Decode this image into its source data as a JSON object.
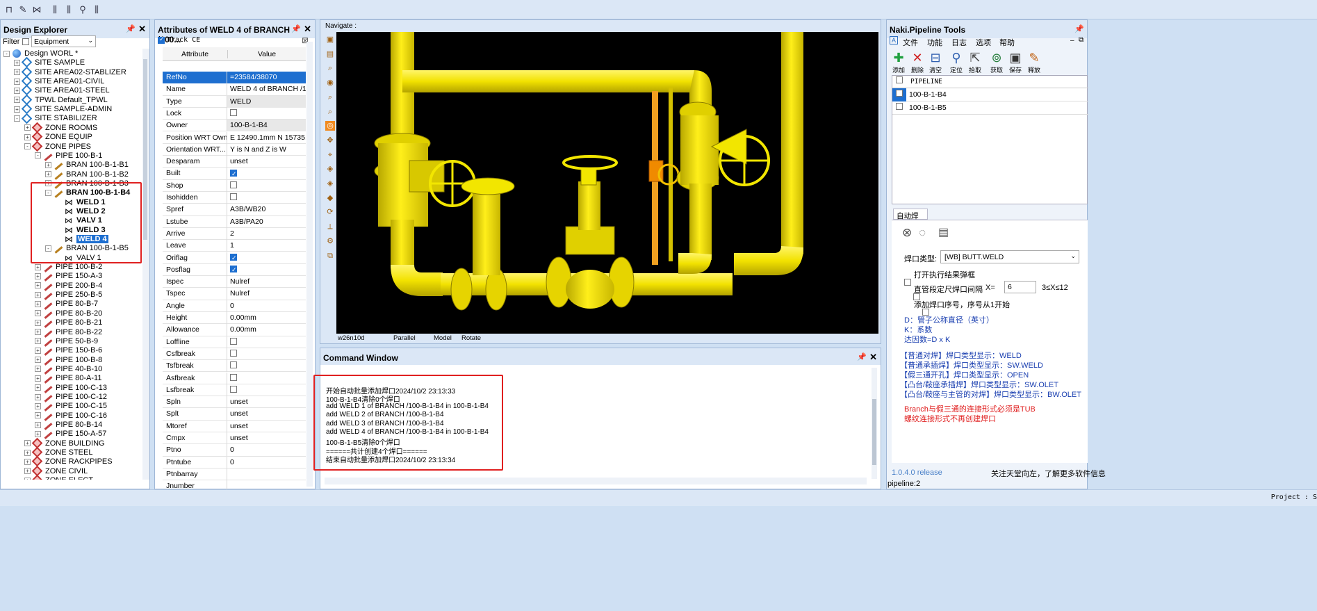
{
  "toolbar": {
    "icons": [
      "pipe-tool-icon",
      "pencil-icon",
      "pipe-edit-icon",
      "valve-a-icon",
      "valve-b-icon",
      "valve-c-icon",
      "valve-d-icon",
      "valve-e-icon"
    ]
  },
  "design_explorer": {
    "title": "Design Explorer",
    "filter_label": "Filter",
    "filter_value": "Equipment",
    "tree": [
      {
        "label": "Design WORL *",
        "level": 0,
        "icon": "globe",
        "exp": "-"
      },
      {
        "label": "SITE SAMPLE",
        "level": 1,
        "icon": "site",
        "exp": "+"
      },
      {
        "label": "SITE AREA02-STABLIZER",
        "level": 1,
        "icon": "site",
        "exp": "+"
      },
      {
        "label": "SITE AREA01-CIVIL",
        "level": 1,
        "icon": "site",
        "exp": "+"
      },
      {
        "label": "SITE AREA01-STEEL",
        "level": 1,
        "icon": "site",
        "exp": "+"
      },
      {
        "label": "TPWL Default_TPWL",
        "level": 1,
        "icon": "site",
        "exp": "+"
      },
      {
        "label": "SITE SAMPLE-ADMIN",
        "level": 1,
        "icon": "site",
        "exp": "+"
      },
      {
        "label": "SITE STABILIZER",
        "level": 1,
        "icon": "site",
        "exp": "-"
      },
      {
        "label": "ZONE ROOMS",
        "level": 2,
        "icon": "zone",
        "exp": "+"
      },
      {
        "label": "ZONE EQUIP",
        "level": 2,
        "icon": "zone",
        "exp": "+"
      },
      {
        "label": "ZONE PIPES",
        "level": 2,
        "icon": "zone",
        "exp": "-"
      },
      {
        "label": "PIPE 100-B-1",
        "level": 3,
        "icon": "pipe",
        "exp": "-"
      },
      {
        "label": "BRAN 100-B-1-B1",
        "level": 4,
        "icon": "bran",
        "exp": "+"
      },
      {
        "label": "BRAN 100-B-1-B2",
        "level": 4,
        "icon": "bran",
        "exp": "+"
      },
      {
        "label": "BRAN 100-B-1-B3",
        "level": 4,
        "icon": "bran",
        "exp": "+"
      },
      {
        "label": "BRAN 100-B-1-B4",
        "level": 4,
        "icon": "bran",
        "exp": "-",
        "bold": true
      },
      {
        "label": "WELD 1",
        "level": 5,
        "icon": "weld",
        "bold": true
      },
      {
        "label": "WELD 2",
        "level": 5,
        "icon": "weld",
        "bold": true
      },
      {
        "label": "VALV 1",
        "level": 5,
        "icon": "valv",
        "bold": true
      },
      {
        "label": "WELD 3",
        "level": 5,
        "icon": "weld",
        "bold": true
      },
      {
        "label": "WELD 4",
        "level": 5,
        "icon": "weld",
        "bold": true,
        "selected": true
      },
      {
        "label": "BRAN 100-B-1-B5",
        "level": 4,
        "icon": "bran",
        "exp": "-"
      },
      {
        "label": "VALV 1",
        "level": 5,
        "icon": "valv"
      },
      {
        "label": "PIPE 100-B-2",
        "level": 3,
        "icon": "pipe",
        "exp": "+"
      },
      {
        "label": "PIPE 150-A-3",
        "level": 3,
        "icon": "pipe",
        "exp": "+"
      },
      {
        "label": "PIPE 200-B-4",
        "level": 3,
        "icon": "pipe",
        "exp": "+"
      },
      {
        "label": "PIPE 250-B-5",
        "level": 3,
        "icon": "pipe",
        "exp": "+"
      },
      {
        "label": "PIPE 80-B-7",
        "level": 3,
        "icon": "pipe",
        "exp": "+"
      },
      {
        "label": "PIPE 80-B-20",
        "level": 3,
        "icon": "pipe",
        "exp": "+"
      },
      {
        "label": "PIPE 80-B-21",
        "level": 3,
        "icon": "pipe",
        "exp": "+"
      },
      {
        "label": "PIPE 80-B-22",
        "level": 3,
        "icon": "pipe",
        "exp": "+"
      },
      {
        "label": "PIPE 50-B-9",
        "level": 3,
        "icon": "pipe",
        "exp": "+"
      },
      {
        "label": "PIPE 150-B-6",
        "level": 3,
        "icon": "pipe",
        "exp": "+"
      },
      {
        "label": "PIPE 100-B-8",
        "level": 3,
        "icon": "pipe",
        "exp": "+"
      },
      {
        "label": "PIPE 40-B-10",
        "level": 3,
        "icon": "pipe",
        "exp": "+"
      },
      {
        "label": "PIPE 80-A-11",
        "level": 3,
        "icon": "pipe",
        "exp": "+"
      },
      {
        "label": "PIPE 100-C-13",
        "level": 3,
        "icon": "pipe",
        "exp": "+"
      },
      {
        "label": "PIPE 100-C-12",
        "level": 3,
        "icon": "pipe",
        "exp": "+"
      },
      {
        "label": "PIPE 100-C-15",
        "level": 3,
        "icon": "pipe",
        "exp": "+"
      },
      {
        "label": "PIPE 100-C-16",
        "level": 3,
        "icon": "pipe",
        "exp": "+"
      },
      {
        "label": "PIPE 80-B-14",
        "level": 3,
        "icon": "pipe",
        "exp": "+"
      },
      {
        "label": "PIPE 150-A-57",
        "level": 3,
        "icon": "pipe",
        "exp": "+"
      },
      {
        "label": "ZONE BUILDING",
        "level": 2,
        "icon": "zone",
        "exp": "+"
      },
      {
        "label": "ZONE STEEL",
        "level": 2,
        "icon": "zone",
        "exp": "+"
      },
      {
        "label": "ZONE RACKPIPES",
        "level": 2,
        "icon": "zone",
        "exp": "+"
      },
      {
        "label": "ZONE CIVIL",
        "level": 2,
        "icon": "zone",
        "exp": "+"
      },
      {
        "label": "ZONE ELECT",
        "level": 2,
        "icon": "zone",
        "exp": "+"
      }
    ]
  },
  "attributes": {
    "title": "Attributes of WELD 4 of BRANCH /100...",
    "track_label": "Track CE",
    "col_attribute": "Attribute",
    "col_value": "Value",
    "rows": [
      {
        "name": "RefNo",
        "value": "=23584/38070",
        "selected": true
      },
      {
        "name": "Name",
        "value": "WELD 4 of BRANCH /1..."
      },
      {
        "name": "Type",
        "value": "WELD",
        "gray": true
      },
      {
        "name": "Lock",
        "check": false
      },
      {
        "name": "Owner",
        "value": "100-B-1-B4",
        "gray": true
      },
      {
        "name": "Position WRT Owner",
        "value": "E 12490.1mm N 15735...."
      },
      {
        "name": "Orientation WRT...",
        "value": "Y is N and Z is W"
      },
      {
        "name": "Desparam",
        "value": "unset"
      },
      {
        "name": "Built",
        "check": true
      },
      {
        "name": "Shop",
        "check": false
      },
      {
        "name": "Isohidden",
        "check": false
      },
      {
        "name": "Spref",
        "value": "A3B/WB20"
      },
      {
        "name": "Lstube",
        "value": "A3B/PA20"
      },
      {
        "name": "Arrive",
        "value": "2"
      },
      {
        "name": "Leave",
        "value": "1"
      },
      {
        "name": "Oriflag",
        "check": true
      },
      {
        "name": "Posflag",
        "check": true
      },
      {
        "name": "Ispec",
        "value": "Nulref"
      },
      {
        "name": "Tspec",
        "value": "Nulref"
      },
      {
        "name": "Angle",
        "value": "0"
      },
      {
        "name": "Height",
        "value": "0.00mm"
      },
      {
        "name": "Allowance",
        "value": "0.00mm"
      },
      {
        "name": "Loffline",
        "check": false
      },
      {
        "name": "Csfbreak",
        "check": false
      },
      {
        "name": "Tsfbreak",
        "check": false
      },
      {
        "name": "Asfbreak",
        "check": false
      },
      {
        "name": "Lsfbreak",
        "check": false
      },
      {
        "name": "Spln",
        "value": "unset"
      },
      {
        "name": "Splt",
        "value": "unset"
      },
      {
        "name": "Mtoref",
        "value": "unset"
      },
      {
        "name": "Cmpx",
        "value": "unset"
      },
      {
        "name": "Ptno",
        "value": "0"
      },
      {
        "name": "Ptntube",
        "value": "0"
      },
      {
        "name": "Ptnbarray",
        "value": ""
      },
      {
        "name": "Jnumber",
        "value": ""
      }
    ]
  },
  "navigate": {
    "title": "Navigate :",
    "status": [
      "w26n10d",
      "Parallel",
      "Model",
      "Rotate"
    ]
  },
  "command_window": {
    "title": "Command Window",
    "lines": [
      "开始自动批量添加焊口2024/10/2 23:13:33",
      "100-B-1-B4清除0个焊口",
      "add WELD 1 of BRANCH /100-B-1-B4 in 100-B-1-B4",
      "add WELD 2 of BRANCH /100-B-1-B4",
      "add WELD 3 of BRANCH /100-B-1-B4",
      "add WELD 4 of BRANCH /100-B-1-B4 in 100-B-1-B4",
      "100-B-1-B5清除0个焊口",
      "======共计创建4个焊口======",
      "结束自动批量添加焊口2024/10/2 23:13:34"
    ]
  },
  "naki": {
    "title": "Naki.Pipeline Tools",
    "menu": [
      "文件",
      "功能",
      "日志",
      "选项",
      "帮助"
    ],
    "tools": [
      {
        "label": "添加",
        "icon": "add-icon"
      },
      {
        "label": "删除",
        "icon": "delete-icon"
      },
      {
        "label": "清空",
        "icon": "clear-icon"
      },
      {
        "label": "定位",
        "icon": "locate-icon"
      },
      {
        "label": "拾取",
        "icon": "pick-icon"
      },
      {
        "label": "获取",
        "icon": "fetch-icon"
      },
      {
        "label": "保存",
        "icon": "save-icon"
      },
      {
        "label": "释放",
        "icon": "release-icon"
      }
    ],
    "list_header": "PIPELINE",
    "list_items": [
      "100-B-1-B4",
      "100-B-1-B5"
    ],
    "tab_label": "自动焊口",
    "weld_type_label": "焊口类型:",
    "weld_type_value": "[WB] BUTT.WELD",
    "opt_open_result": "打开执行结果弹框",
    "opt_spacing": "直管段定尺焊口间隔",
    "x_label": "X=",
    "x_value": "6",
    "x_range": "3≤X≤12",
    "opt_seq": "添加焊口序号，序号从1开始",
    "info_blue": [
      "D：管子公称直径（英寸）",
      "K：系数",
      "达因数=D x K"
    ],
    "info_types": [
      "【普通对焊】焊口类型显示：WELD",
      "【普通承插焊】焊口类型显示：SW.WELD",
      "【假三通开孔】焊口类型显示：OPEN",
      "【凸台/鞍座承插焊】焊口类型显示：SW.OLET",
      "【凸台/鞍座与主管的对焊】焊口类型显示：BW.OLET"
    ],
    "info_red": [
      "Branch与假三通的连接形式必须是TUB",
      "螺纹连接形式不再创建焊口"
    ],
    "version": "1.0.4.0 release",
    "footer_note": "关注天堂向左，了解更多软件信息",
    "status": "pipeline:2"
  },
  "statusbar": {
    "project": "Project : S"
  },
  "colors": {
    "pipe_yellow": "#f2e600",
    "selection_blue": "#1e6fd0",
    "highlight_red": "#e02020"
  }
}
